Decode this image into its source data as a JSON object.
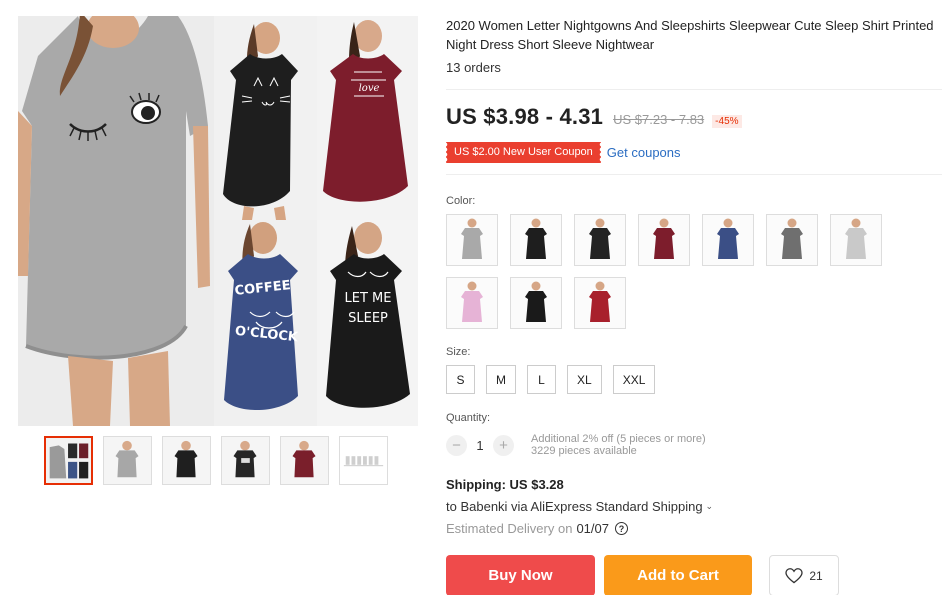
{
  "product": {
    "title": "2020 Women Letter Nightgowns And Sleepshirts Sleepwear Cute Sleep Shirt Printed Night Dress Short Sleeve Nightwear",
    "orders": "13 orders"
  },
  "pricing": {
    "price": "US $3.98 - 4.31",
    "original_price": "US $7.23 - 7.83",
    "discount": "-45%",
    "coupon": "US $2.00 New User Coupon",
    "get_coupons": "Get coupons"
  },
  "gallery": {
    "dress_prints": {
      "coffee": [
        "COFFEE",
        "O'CLOCK"
      ],
      "sleep": [
        "LET ME",
        "SLEEP"
      ],
      "love": "love"
    },
    "thumbnails": [
      {
        "name": "thumb-collage",
        "colors": [
          "#9a9a9a",
          "#2a2a2a",
          "#6b1f2a",
          "#3d5486"
        ]
      },
      {
        "name": "thumb-gray",
        "colors": [
          "#a7a7a7"
        ]
      },
      {
        "name": "thumb-black-cat",
        "colors": [
          "#1f1f1f"
        ]
      },
      {
        "name": "thumb-black-print",
        "colors": [
          "#262626"
        ]
      },
      {
        "name": "thumb-wine",
        "colors": [
          "#7a1f2b"
        ]
      },
      {
        "name": "thumb-size-chart",
        "colors": [
          "#dddddd"
        ]
      }
    ]
  },
  "options": {
    "color_label": "Color:",
    "colors": [
      {
        "name": "swatch-gray",
        "dress": "#a9a9a9"
      },
      {
        "name": "swatch-black-cat",
        "dress": "#1e1e1e"
      },
      {
        "name": "swatch-black-print",
        "dress": "#232323"
      },
      {
        "name": "swatch-wine",
        "dress": "#7d1d2c"
      },
      {
        "name": "swatch-navy",
        "dress": "#3b4f86"
      },
      {
        "name": "swatch-striped-gray",
        "dress": "#6f6f6f"
      },
      {
        "name": "swatch-light-gray",
        "dress": "#c9c9c9"
      },
      {
        "name": "swatch-pink",
        "dress": "#e6b3d6"
      },
      {
        "name": "swatch-black-plain",
        "dress": "#1a1a1a"
      },
      {
        "name": "swatch-red",
        "dress": "#a8202c"
      }
    ],
    "size_label": "Size:",
    "sizes": [
      "S",
      "M",
      "L",
      "XL",
      "XXL"
    ]
  },
  "quantity": {
    "label": "Quantity:",
    "minus": "−",
    "plus": "+",
    "value": "1",
    "note1": "Additional 2% off (5 pieces or more)",
    "note2": "3229 pieces available"
  },
  "shipping": {
    "cost": "Shipping: US $3.28",
    "method": "to Babenki via AliExpress Standard Shipping",
    "delivery_label": "Estimated Delivery on",
    "delivery_date": "01/07"
  },
  "actions": {
    "buy_now": "Buy Now",
    "add_to_cart": "Add to Cart",
    "wishlist_count": "21"
  },
  "colors": {
    "accent_red": "#ea3f2f",
    "buy_button": "#ef4b4b",
    "cart_button": "#fa9a1a",
    "link_blue": "#2b6dc2"
  }
}
